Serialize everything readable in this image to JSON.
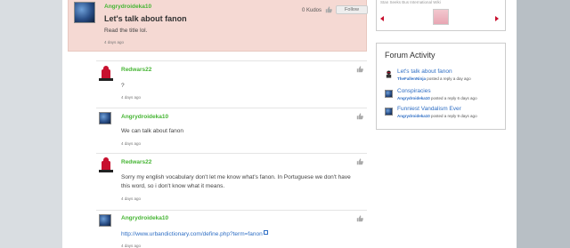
{
  "thread": {
    "op": {
      "username": "Angrydroideka10",
      "title": "Let's talk about fanon",
      "body": "Read the title lol.",
      "time": "4 days ago",
      "kudos": "0 Kudos",
      "follow_label": "Follow"
    },
    "replies": [
      {
        "username": "Redwars22",
        "avatar": "red-figure",
        "body": "?",
        "time": "4 days ago"
      },
      {
        "username": "Angrydroideka10",
        "avatar": "globe",
        "body": "We can talk about fanon",
        "time": "4 days ago"
      },
      {
        "username": "Redwars22",
        "avatar": "red-figure",
        "body_line1": "Sorry my english vocabulary don't let me know what's fanon. In Portuguese we don't have",
        "body_line2": "this word, so i don't know what it means.",
        "time": "4 days ago"
      },
      {
        "username": "Angrydroideka10",
        "avatar": "globe",
        "link": "http://www.urbandictionary.com/define.php?term=fanon",
        "time": "4 days ago"
      }
    ]
  },
  "rail": {
    "top_snippet": "Stan Seeks Bus International Wiki",
    "forum_activity": {
      "title": "Forum Activity",
      "items": [
        {
          "title": "Let's talk about fanon",
          "who": "TheFallenNinja",
          "meta": "posted a reply a day ago"
        },
        {
          "title": "Conspiracies",
          "who": "Angrydroideka10",
          "meta": "posted a reply 6 days ago"
        },
        {
          "title": "Funniest Vandalism Ever",
          "who": "Angrydroideka10",
          "meta": "posted a reply 9 days ago"
        }
      ]
    }
  },
  "colors": {
    "username": "#46b534",
    "link": "#2e6ec4",
    "op_bg": "#f5d9d3",
    "arrow": "#c8102e"
  }
}
